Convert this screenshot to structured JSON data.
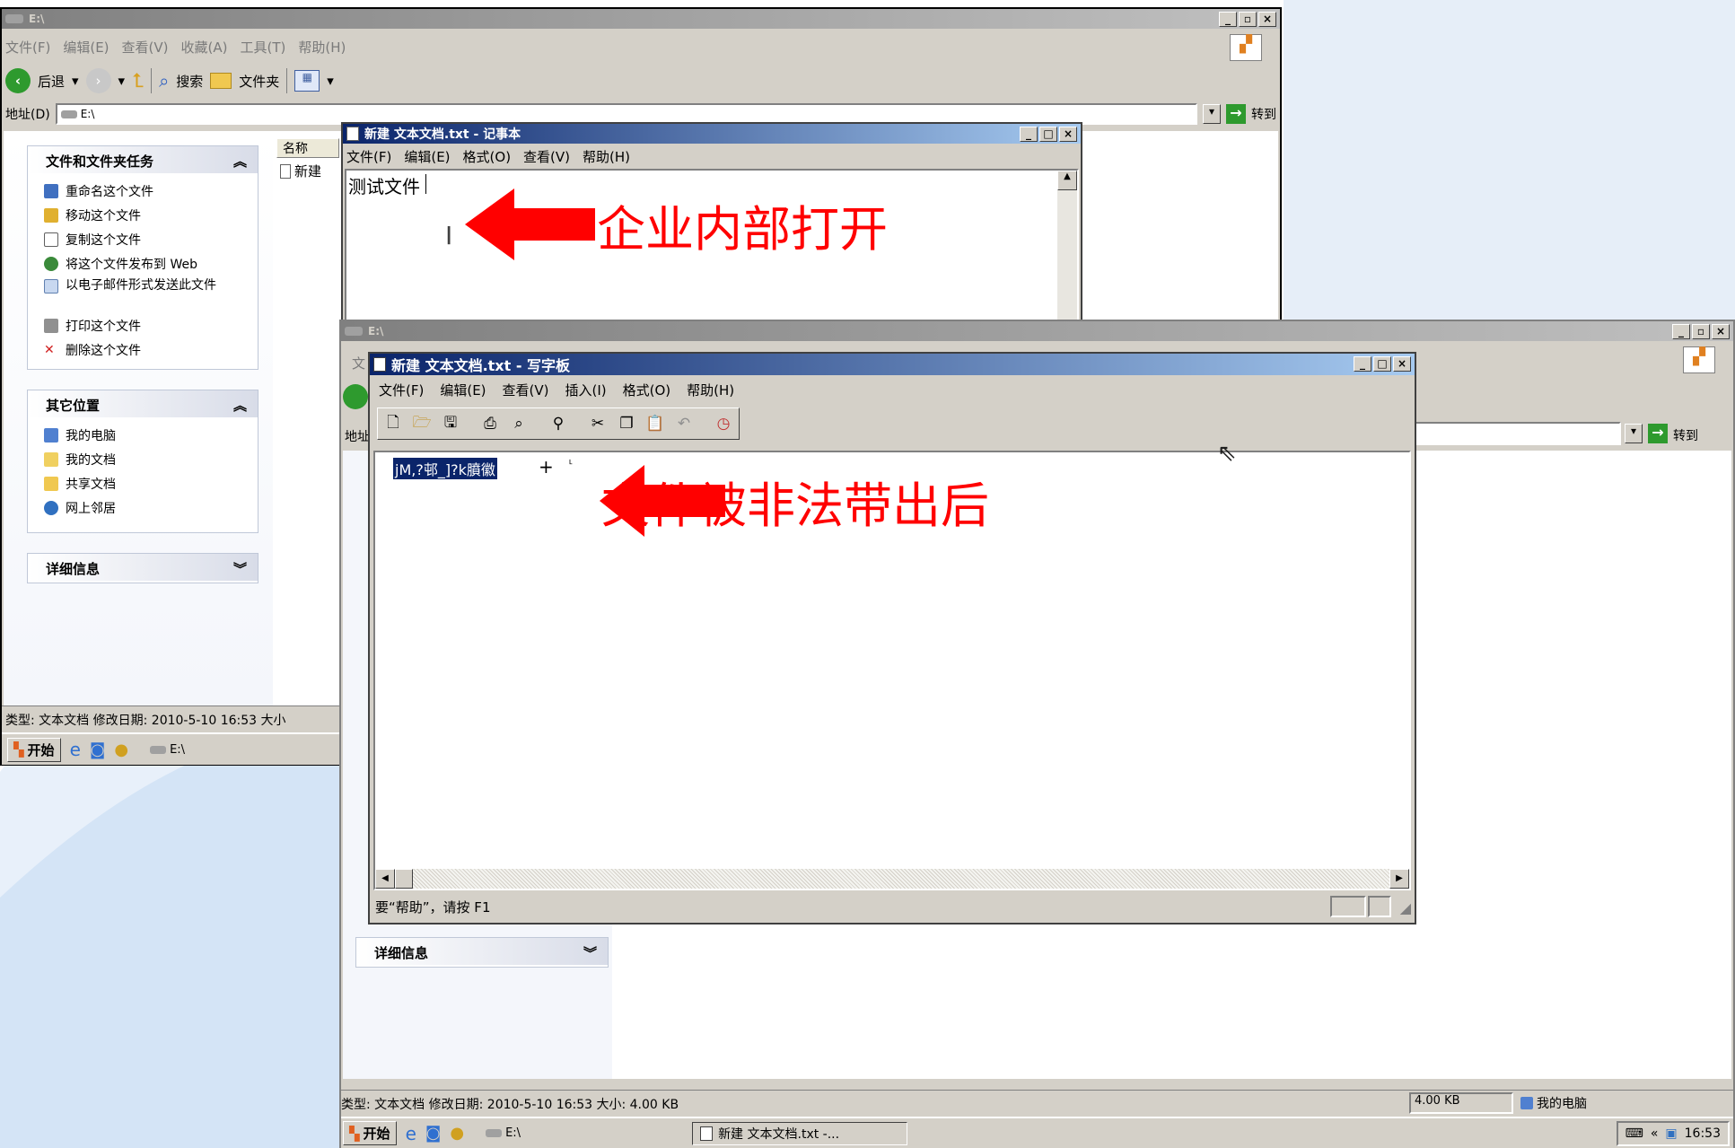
{
  "explorer_back": {
    "title": "E:\\",
    "menu": [
      "文件(F)",
      "编辑(E)",
      "查看(V)",
      "收藏(A)",
      "工具(T)",
      "帮助(H)"
    ],
    "toolbar": {
      "back": "后退",
      "search": "搜索",
      "folders": "文件夹"
    },
    "address_label": "地址(D)",
    "address_value": "E:\\",
    "go_label": "转到",
    "column_name": "名称",
    "file_item": "新建",
    "tasks_title": "文件和文件夹任务",
    "tasks": [
      "重命名这个文件",
      "移动这个文件",
      "复制这个文件",
      "将这个文件发布到 Web",
      "以电子邮件形式发送此文件",
      "打印这个文件",
      "删除这个文件"
    ],
    "places_title": "其它位置",
    "places": [
      "我的电脑",
      "我的文档",
      "共享文档",
      "网上邻居"
    ],
    "details_title": "详细信息",
    "status_text": "类型: 文本文档 修改日期: 2010-5-10 16:53 大小",
    "taskbar": {
      "start": "开始",
      "item": "E:\\"
    }
  },
  "notepad": {
    "title": "新建 文本文档.txt - 记事本",
    "menu": [
      "文件(F)",
      "编辑(E)",
      "格式(O)",
      "查看(V)",
      "帮助(H)"
    ],
    "content": "测试文件"
  },
  "explorer_front": {
    "title": "E:\\",
    "address_partial": "地址",
    "menu_partial": "文",
    "go_label": "转到",
    "details_title": "详细信息",
    "status_text": "类型: 文本文档 修改日期: 2010-5-10 16:53 大小: 4.00 KB",
    "status_size": "4.00 KB",
    "status_location": "我的电脑",
    "taskbar": {
      "start": "开始",
      "item1": "E:\\",
      "item2": "新建 文本文档.txt -...",
      "clock": "16:53"
    }
  },
  "wordpad": {
    "title": "新建 文本文档.txt - 写字板",
    "menu": [
      "文件(F)",
      "编辑(E)",
      "查看(V)",
      "插入(I)",
      "格式(O)",
      "帮助(H)"
    ],
    "garbled_text": "jM,?邨_]?k膹徽",
    "status_text": "要“帮助”，请按 F1"
  },
  "annotations": {
    "top": "企业内部打开",
    "bottom": "文件被非法带出后",
    "color": "#ff0000"
  },
  "colors": {
    "active_title": "#0a246a",
    "win_face": "#d4d0c8",
    "select_bg": "#0a246a"
  }
}
